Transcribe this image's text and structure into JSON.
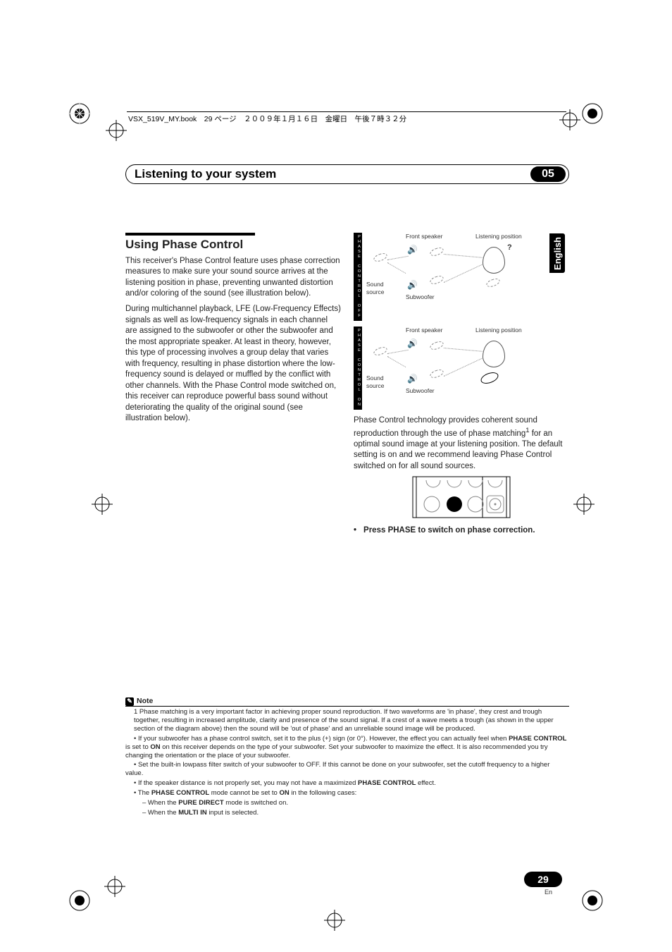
{
  "file_header": "VSX_519V_MY.book　29 ページ　２００９年１月１６日　金曜日　午後７時３２分",
  "chapter": {
    "title": "Listening to your system",
    "number": "05"
  },
  "lang_tab": "English",
  "section": {
    "heading": "Using Phase Control",
    "para1": "This receiver's Phase Control feature uses phase correction measures to make sure your sound source arrives at the listening position in phase, preventing unwanted distortion and/or coloring of the sound (see illustration below).",
    "para2": "During multichannel playback, LFE (Low-Frequency Effects) signals as well as low-frequency signals in each channel are assigned to the subwoofer or other the subwoofer and the most appropriate speaker. At least in theory, however, this type of processing involves a group delay that varies with frequency, resulting in phase distortion where the low-frequency sound is delayed or muffled by the conflict with other channels. With the Phase Control mode switched on, this receiver can reproduce powerful bass sound without deteriorating the quality of the original sound (see illustration below)."
  },
  "diagram": {
    "off_label": "PHASE CONTROL OFF",
    "on_label": "PHASE CONTROL ON",
    "front_speaker": "Front speaker",
    "listening_position": "Listening position",
    "sound_source": "Sound source",
    "subwoofer": "Subwoofer",
    "qmark": "?"
  },
  "right_col": {
    "para1_a": "Phase Control technology provides coherent sound reproduction through the use of phase matching",
    "sup": "1",
    "para1_b": " for an optimal sound image at your listening position. The default setting is on and we recommend leaving Phase Control switched on for all sound sources.",
    "bullet_lead": "•",
    "bullet_a": "Press ",
    "bullet_b": "PHASE",
    "bullet_c": " to switch on phase correction."
  },
  "notes": {
    "heading": "Note",
    "n1": "1  Phase matching is a very important factor in achieving proper sound reproduction. If two waveforms are 'in phase', they crest and trough together, resulting in increased amplitude, clarity and presence of the sound signal. If a crest of a wave meets a trough (as shown in the upper section of the diagram above) then the sound will be 'out of phase' and an unreliable sound image will be produced.",
    "n2a": "• If your subwoofer has a phase control switch, set it to the plus (+) sign (or 0°). However, the effect you can actually feel when ",
    "n2b": "PHASE CONTROL",
    "n2c": " is set to ",
    "n2d": "ON",
    "n2e": " on this receiver depends on the type of your subwoofer. Set your subwoofer to maximize the effect. It is also recommended you try changing the orientation or the place of your subwoofer.",
    "n3": "• Set the built-in lowpass filter switch of your subwoofer to OFF. If this cannot be done on your subwoofer, set the cutoff frequency to a higher value.",
    "n4a": "• If the speaker distance is not properly set, you may not have a maximized ",
    "n4b": "PHASE CONTROL",
    "n4c": " effect.",
    "n5a": "• The ",
    "n5b": "PHASE CONTROL",
    "n5c": " mode cannot be set to ",
    "n5d": "ON",
    "n5e": " in the following cases:",
    "n6a": "– When the ",
    "n6b": "PURE DIRECT",
    "n6c": " mode is switched on.",
    "n7a": "– When the ",
    "n7b": "MULTI IN",
    "n7c": " input is selected."
  },
  "page": {
    "number": "29",
    "lang": "En"
  }
}
